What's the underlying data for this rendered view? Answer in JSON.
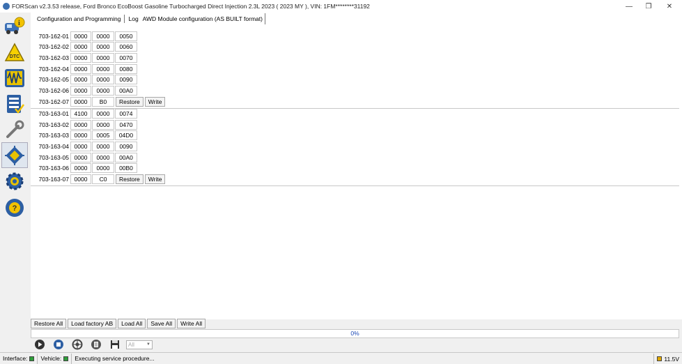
{
  "window": {
    "title": "FORScan v2.3.53 release, Ford Bronco EcoBoost Gasoline Turbocharged Direct Injection 2.3L 2023 ( 2023 MY ), VIN: 1FM********31192",
    "minimize_glyph": "—",
    "restore_glyph": "❐",
    "close_glyph": "✕"
  },
  "sidebar": {
    "items": [
      {
        "name": "vehicle-info-icon"
      },
      {
        "name": "dtc-icon",
        "label": "DTC"
      },
      {
        "name": "oscilloscope-icon"
      },
      {
        "name": "checklist-icon"
      },
      {
        "name": "wrench-icon"
      },
      {
        "name": "chip-icon"
      },
      {
        "name": "gear-settings-icon"
      },
      {
        "name": "help-icon"
      }
    ]
  },
  "tabs": {
    "config": "Configuration and Programming",
    "log": "Log",
    "awd": "AWD Module configuration (AS BUILT format)"
  },
  "groups": [
    {
      "rows": [
        {
          "addr": "703-162-01",
          "c1": "0000",
          "c2": "0000",
          "c3": "0050"
        },
        {
          "addr": "703-162-02",
          "c1": "0000",
          "c2": "0000",
          "c3": "0060"
        },
        {
          "addr": "703-162-03",
          "c1": "0000",
          "c2": "0000",
          "c3": "0070"
        },
        {
          "addr": "703-162-04",
          "c1": "0000",
          "c2": "0000",
          "c3": "0080"
        },
        {
          "addr": "703-162-05",
          "c1": "0000",
          "c2": "0000",
          "c3": "0090"
        },
        {
          "addr": "703-162-06",
          "c1": "0000",
          "c2": "0000",
          "c3": "00A0"
        },
        {
          "addr": "703-162-07",
          "c1": "0000",
          "c2": "B0",
          "restore": "Restore",
          "write": "Write"
        }
      ]
    },
    {
      "rows": [
        {
          "addr": "703-163-01",
          "c1": "4100",
          "c2": "0000",
          "c3": "0074"
        },
        {
          "addr": "703-163-02",
          "c1": "0000",
          "c2": "0000",
          "c3": "0470"
        },
        {
          "addr": "703-163-03",
          "c1": "0000",
          "c2": "0005",
          "c3": "04D0"
        },
        {
          "addr": "703-163-04",
          "c1": "0000",
          "c2": "0000",
          "c3": "0090"
        },
        {
          "addr": "703-163-05",
          "c1": "0000",
          "c2": "0000",
          "c3": "00A0"
        },
        {
          "addr": "703-163-06",
          "c1": "0000",
          "c2": "0000",
          "c3": "00B0"
        },
        {
          "addr": "703-163-07",
          "c1": "0000",
          "c2": "C0",
          "restore": "Restore",
          "write": "Write"
        }
      ]
    }
  ],
  "actions": {
    "restore_all": "Restore All",
    "load_factory": "Load factory AB",
    "load_all": "Load All",
    "save_all": "Save All",
    "write_all": "Write All"
  },
  "progress": {
    "text": "0%",
    "value": 0
  },
  "toolbar": {
    "select_value": "All",
    "tools": [
      "play-icon",
      "stop-icon",
      "reset-icon",
      "clear-icon",
      "save-icon"
    ]
  },
  "status": {
    "interface_label": "Interface:",
    "vehicle_label": "Vehicle:",
    "message": "Executing service procedure...",
    "voltage": "11.5V",
    "colors": {
      "ok": "#2e9e3a",
      "voltage": "#e0a800"
    }
  }
}
